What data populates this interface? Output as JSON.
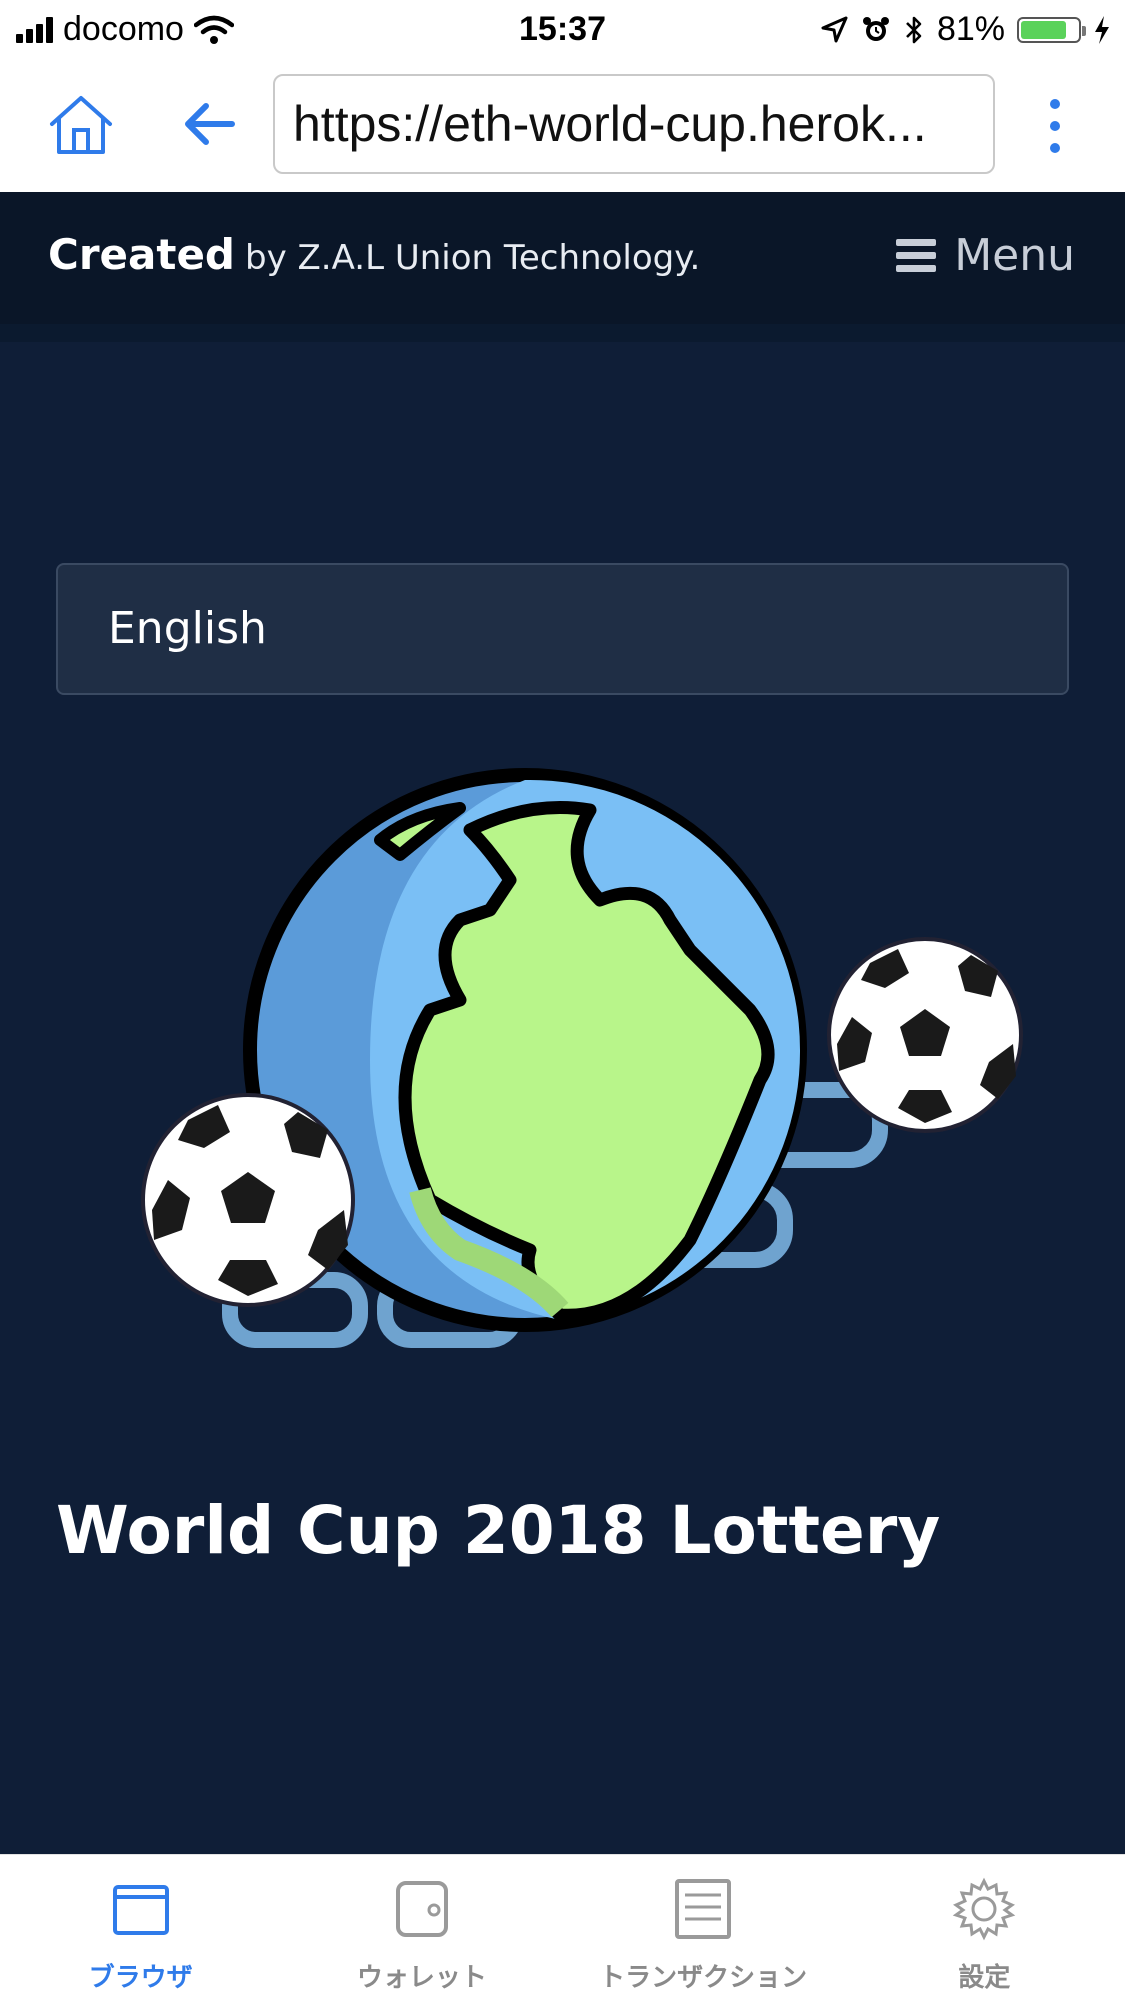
{
  "status_bar": {
    "carrier": "docomo",
    "time": "15:37",
    "battery_percent": "81%",
    "battery_level": 0.81
  },
  "browser": {
    "url": "https://eth-world-cup.herok..."
  },
  "header": {
    "brand_strong": "Created",
    "brand_rest": "by Z.A.L Union Technology.",
    "menu_label": "Menu"
  },
  "language_select": {
    "selected": "English"
  },
  "hero": {
    "image_icon": "globe-with-soccer-balls-chain"
  },
  "page_title": "World Cup 2018 Lottery",
  "tabs": [
    {
      "label": "ブラウザ",
      "icon": "browser-icon",
      "active": true
    },
    {
      "label": "ウォレット",
      "icon": "wallet-icon",
      "active": false
    },
    {
      "label": "トランザクション",
      "icon": "transactions-icon",
      "active": false
    },
    {
      "label": "設定",
      "icon": "gear-icon",
      "active": false
    }
  ],
  "colors": {
    "page_bg": "#0f1e37",
    "header_bg": "#0a1628",
    "accent": "#2f7bea",
    "globe_ocean": "#5b9bd9",
    "globe_land": "#b8f58a"
  }
}
